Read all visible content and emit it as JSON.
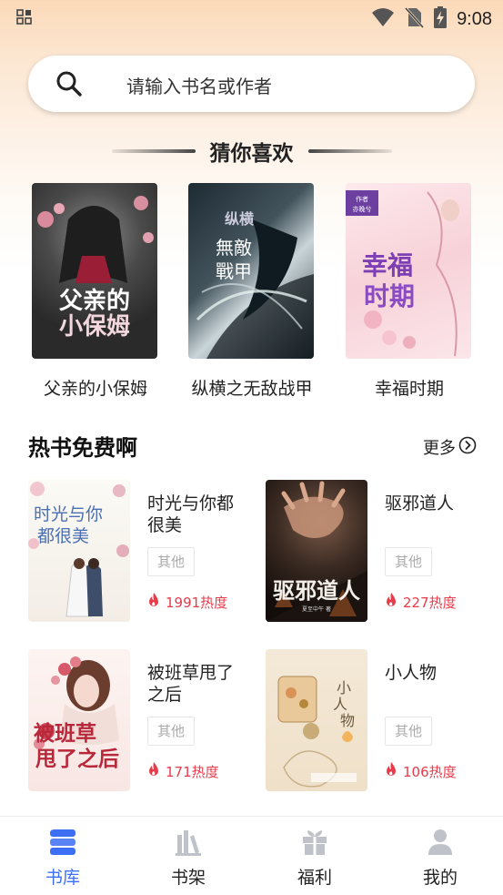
{
  "status_bar": {
    "time": "9:08"
  },
  "search": {
    "placeholder": "请输入书名或作者"
  },
  "guess_section": {
    "title": "猜你喜欢",
    "books": [
      {
        "title": "父亲的小保姆",
        "cover_text": "父亲的小保姆"
      },
      {
        "title": "纵横之无敌战甲",
        "cover_text": "纵横之无敌战甲"
      },
      {
        "title": "幸福时期",
        "cover_text": "幸福时期"
      }
    ]
  },
  "hot_section": {
    "title": "热书免费啊",
    "more_label": "更多",
    "books": [
      {
        "name": "时光与你都很美",
        "tag": "其他",
        "heat": "1991热度",
        "cover_text": "时光与你都很美"
      },
      {
        "name": "驱邪道人",
        "tag": "其他",
        "heat": "227热度",
        "cover_text": "驱邪道人"
      },
      {
        "name": "被班草甩了之后",
        "tag": "其他",
        "heat": "171热度",
        "cover_text": "被班草甩了之后"
      },
      {
        "name": "小人物",
        "tag": "其他",
        "heat": "106热度",
        "cover_text": "小人物"
      }
    ]
  },
  "tab_bar": {
    "tabs": [
      {
        "label": "书库",
        "icon": "library-icon",
        "active": true
      },
      {
        "label": "书架",
        "icon": "bookshelf-icon",
        "active": false
      },
      {
        "label": "福利",
        "icon": "gift-icon",
        "active": false
      },
      {
        "label": "我的",
        "icon": "user-icon",
        "active": false
      }
    ]
  },
  "colors": {
    "accent": "#3d6ff5",
    "heat": "#e83b4b"
  }
}
